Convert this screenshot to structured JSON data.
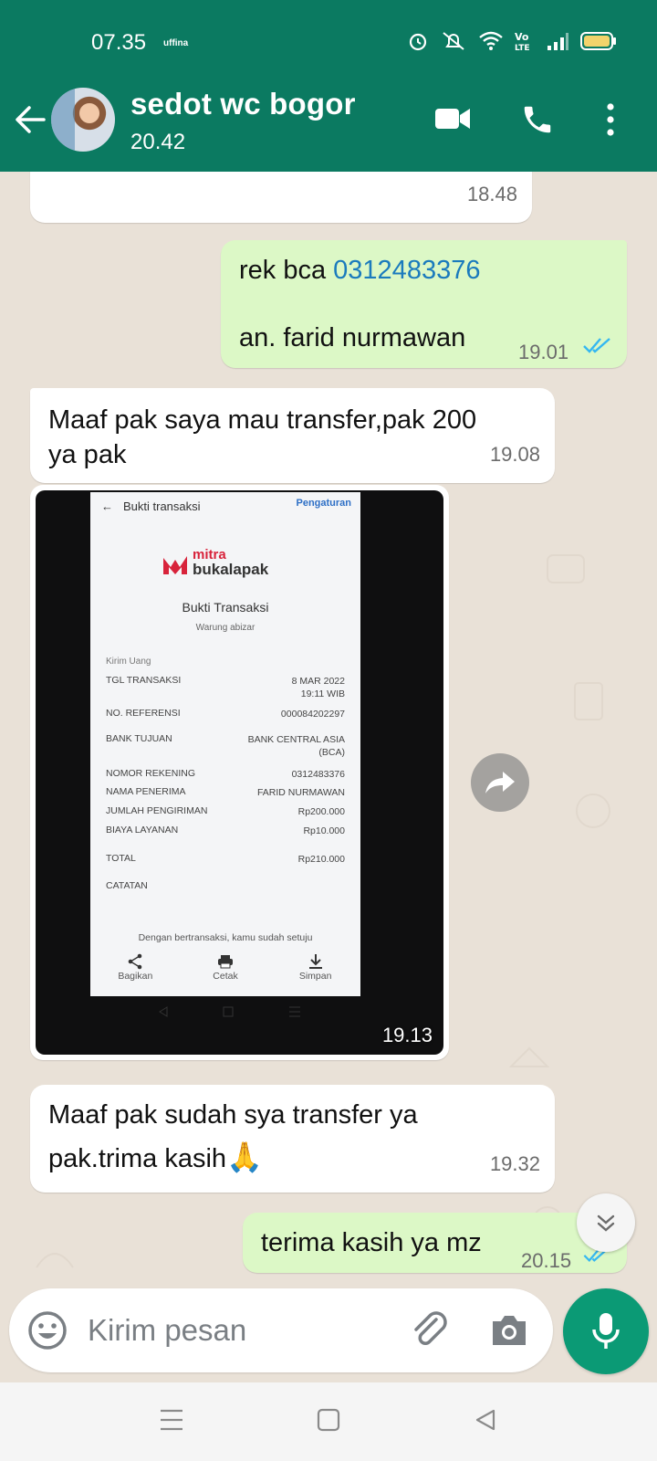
{
  "status_bar": {
    "time": "07.35",
    "carrier": "uffina"
  },
  "header": {
    "contact_name": "sedot wc bogor",
    "last_seen": "20.42"
  },
  "messages": [
    {
      "type": "in",
      "text": "",
      "time": "18.48"
    },
    {
      "type": "out",
      "line1_prefix": "rek bca ",
      "account_link": "0312483376",
      "line2": "an. farid nurmawan",
      "time": "19.01"
    },
    {
      "type": "in",
      "text_line1": "Maaf pak saya mau transfer,pak 200",
      "text_line2": "ya pak",
      "time": "19.08"
    },
    {
      "type": "image",
      "time": "19.13"
    },
    {
      "type": "in",
      "text_line1": "Maaf pak sudah sya transfer ya",
      "text_line2": "pak.trima kasih",
      "emoji": "🙏",
      "time": "19.32"
    },
    {
      "type": "out",
      "text": "terima kasih ya mz",
      "time": "20.15"
    }
  ],
  "receipt": {
    "back": "←",
    "title": "Bukti transaksi",
    "settings": "Pengaturan",
    "logo_line1": "mitra",
    "logo_line2": "bukalapak",
    "heading": "Bukti Transaksi",
    "merchant": "Warung abizar",
    "section": "Kirim Uang",
    "rows": [
      {
        "label": "TGL TRANSAKSI",
        "value": "8 MAR 2022\n19:11 WIB"
      },
      {
        "label": "NO. REFERENSI",
        "value": "000084202297"
      },
      {
        "label": "BANK TUJUAN",
        "value": "BANK CENTRAL ASIA\n(BCA)"
      },
      {
        "label": "NOMOR REKENING",
        "value": "0312483376"
      },
      {
        "label": "NAMA PENERIMA",
        "value": "FARID NURMAWAN"
      },
      {
        "label": "JUMLAH PENGIRIMAN",
        "value": "Rp200.000"
      },
      {
        "label": "BIAYA LAYANAN",
        "value": "Rp10.000"
      },
      {
        "label": "TOTAL",
        "value": "Rp210.000"
      },
      {
        "label": "CATATAN",
        "value": ""
      }
    ],
    "note": "Dengan bertransaksi, kamu sudah setuju",
    "actions": [
      "Bagikan",
      "Cetak",
      "Simpan"
    ]
  },
  "composer": {
    "placeholder": "Kirim pesan"
  },
  "colors": {
    "header_bg": "#0b7a61",
    "chat_bg": "#e9e1d7",
    "outgoing_bubble": "#dcf8c6",
    "incoming_bubble": "#ffffff",
    "read_ticks": "#34b7f1",
    "mic_button": "#0b9a75"
  },
  "icons": [
    "back-arrow-icon",
    "video-call-icon",
    "phone-icon",
    "more-vert-icon",
    "forward-icon",
    "double-chevron-down-icon",
    "emoji-icon",
    "paperclip-icon",
    "camera-icon",
    "mic-icon",
    "menu-icon",
    "home-square-icon",
    "back-triangle-icon"
  ]
}
